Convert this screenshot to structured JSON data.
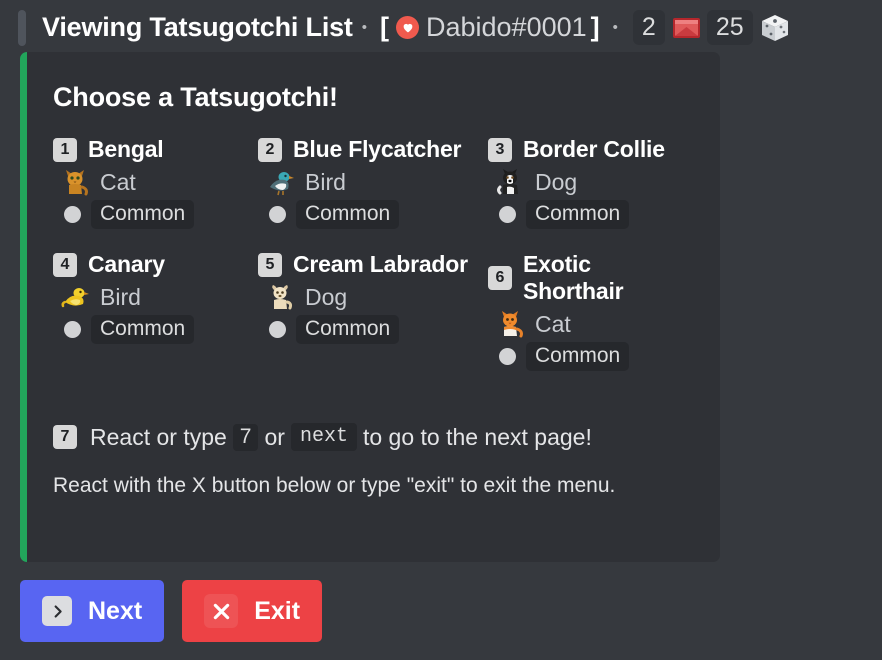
{
  "header": {
    "title": "Viewing Tatsugotchi List",
    "separator": "•",
    "bracket_open": "[",
    "bracket_close": "]",
    "heart_icon": "heart-icon",
    "username": "Dabido#0001",
    "stat1_value": "2",
    "stat1_icon": "gem-icon",
    "stat2_value": "25",
    "stat2_icon": "dice-cube-icon"
  },
  "embed": {
    "accent_color": "#22a55b",
    "background_color": "#2f3136",
    "title": "Choose a Tatsugotchi!",
    "pets": [
      {
        "number": "1",
        "name": "Bengal",
        "species": "Cat",
        "species_icon": "cat-emoji",
        "rarity": "Common",
        "rarity_color": "#d2d3d5"
      },
      {
        "number": "2",
        "name": "Blue Flycatcher",
        "species": "Bird",
        "species_icon": "blue-bird-emoji",
        "rarity": "Common",
        "rarity_color": "#d2d3d5"
      },
      {
        "number": "3",
        "name": "Border Collie",
        "species": "Dog",
        "species_icon": "black-dog-emoji",
        "rarity": "Common",
        "rarity_color": "#d2d3d5"
      },
      {
        "number": "4",
        "name": "Canary",
        "species": "Bird",
        "species_icon": "yellow-bird-emoji",
        "rarity": "Common",
        "rarity_color": "#d2d3d5"
      },
      {
        "number": "5",
        "name": "Cream Labrador",
        "species": "Dog",
        "species_icon": "cream-dog-emoji",
        "rarity": "Common",
        "rarity_color": "#d2d3d5"
      },
      {
        "number": "6",
        "name": "Exotic Shorthair",
        "species": "Cat",
        "species_icon": "orange-cat-emoji",
        "rarity": "Common",
        "rarity_color": "#d2d3d5"
      }
    ],
    "next_hint": {
      "keycap": "7",
      "text_before": "React or type",
      "code_number": "7",
      "text_middle": "or",
      "code_word": "next",
      "text_after": "to go to the next page!"
    },
    "exit_hint": "React with the X button below or type \"exit\" to exit the menu."
  },
  "buttons": {
    "next_label": "Next",
    "next_color": "#5865f2",
    "next_icon": "chevron-right-icon",
    "exit_label": "Exit",
    "exit_color": "#ed4245",
    "exit_icon": "close-x-icon"
  }
}
